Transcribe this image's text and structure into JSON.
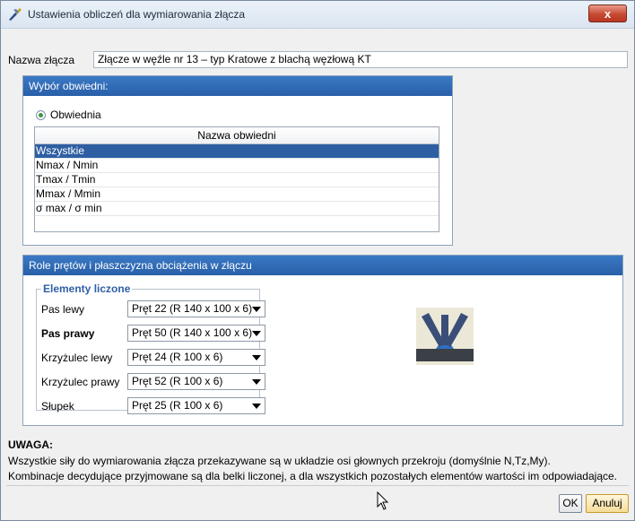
{
  "window": {
    "title": "Ustawienia obliczeń dla wymiarowania złącza",
    "close_label": "x"
  },
  "joint_name": {
    "label": "Nazwa złącza",
    "value": "Złącze w węźle nr 13 – typ Kratowe z blachą węzłową KT"
  },
  "envelope_panel": {
    "title": "Wybór obwiedni:",
    "radio_label": "Obwiednia",
    "table_header": "Nazwa obwiedni",
    "rows": [
      "Wszystkie",
      "Nmax / Nmin",
      "Tmax / Tmin",
      "Mmax / Mmin",
      "σ max / σ min"
    ],
    "selected_index": 0
  },
  "roles_panel": {
    "title": "Role prętów i płaszczyzna obciążenia w złączu",
    "group_title": "Elementy liczone",
    "members": [
      {
        "label": "Pas lewy",
        "value": "Pręt 22 (R 140 x 100 x 6)",
        "bold": false
      },
      {
        "label": "Pas prawy",
        "value": "Pręt 50 (R 140 x 100 x 6)",
        "bold": true
      },
      {
        "label": "Krzyżulec lewy",
        "value": "Pręt 24 (R 100 x 6)",
        "bold": false
      },
      {
        "label": "Krzyżulec prawy",
        "value": "Pręt 52 (R 100 x 6)",
        "bold": false
      },
      {
        "label": "Słupek",
        "value": "Pręt 25 (R 100 x 6)",
        "bold": false
      }
    ]
  },
  "note": {
    "title": "UWAGA:",
    "line1": "Wszystkie siły do wymiarowania złącza przekazywane są w układzie osi głownych przekroju (domyślnie N,Tz,My).",
    "line2": "Kombinacje decydujące przyjmowane są dla belki liczonej, a dla wszystkich pozostałych elementów wartości im odpowiadające."
  },
  "buttons": {
    "ok": "OK",
    "cancel": "Anuluj"
  },
  "colors": {
    "panel_header": "#2f6db8",
    "selection": "#2e5fa3",
    "group_title": "#2f5fa7"
  }
}
